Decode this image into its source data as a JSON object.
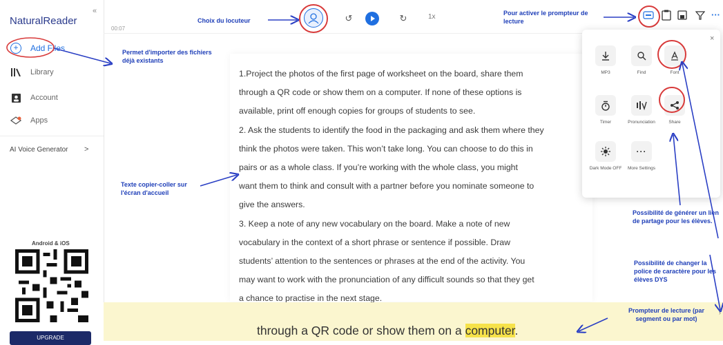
{
  "app": {
    "logo": "NaturalReader",
    "collapse": "«"
  },
  "sidebar": {
    "add_files": "Add Files",
    "library": "Library",
    "account": "Account",
    "apps": "Apps",
    "ai_voice": "AI Voice Generator",
    "ai_chevron": ">",
    "android_ios": "Android & iOS",
    "upgrade": "UPGRADE"
  },
  "player": {
    "time": "00:07",
    "speed": "1x"
  },
  "document": {
    "lines": [
      "1.Project the photos of the first page of worksheet on the board, share them",
      "through a QR code or show them on a computer. If none of these options is",
      "available, print off enough copies for groups of students to see.",
      "2. Ask the students to identify the food in the packaging and ask them where they",
      "think the photos were taken. This won’t take long. You can choose to do this in",
      "pairs or as a whole class. If you’re working with the whole class, you might",
      "want them to think and consult with a partner before you nominate someone to",
      "give the answers.",
      "3. Keep a note of any new vocabulary on the board. Make a note of new",
      "vocabulary in the context of a short phrase or sentence if possible. Draw",
      "students’ attention to the sentences or phrases at the end of the activity. You",
      "may want to work with the pronunciation of any difficult sounds so that they get",
      "a chance to practise in the next stage."
    ]
  },
  "prompter": {
    "before": "through a QR code or show them on a ",
    "highlight": "computer",
    "after": "."
  },
  "menu": {
    "close": "×",
    "items": [
      {
        "label": "MP3",
        "icon": "download-icon"
      },
      {
        "label": "Find",
        "icon": "search-icon"
      },
      {
        "label": "Font",
        "icon": "font-icon"
      },
      {
        "label": "Timer",
        "icon": "timer-icon"
      },
      {
        "label": "Pronunciation",
        "icon": "pronunciation-icon"
      },
      {
        "label": "Share",
        "icon": "share-icon"
      },
      {
        "label": "Dark Mode OFF",
        "icon": "dark-mode-icon"
      },
      {
        "label": "More Settings",
        "icon": "more-icon"
      }
    ]
  },
  "annotations": {
    "choix": "Choix du locuteur",
    "prompteur": "Pour activer le prompteur de lecture",
    "importer": "Permet d'importer des fichiers déjà existants",
    "texte": "Texte copier-coller sur l'écran d'accueil",
    "partage": "Possibilité de générer un lien de partage pour les élèves.",
    "police": "Possibilité de changer la police de caractère pour les élèves DYS",
    "prompteur_lecture": "Prompteur de lecture (par segment ou par mot)"
  },
  "colors": {
    "accent": "#1f6fe0",
    "annotation": "#1f3fb8",
    "red": "#d83a3a",
    "prompter_bg": "#fbf6cf",
    "highlight": "#f6e24a"
  }
}
